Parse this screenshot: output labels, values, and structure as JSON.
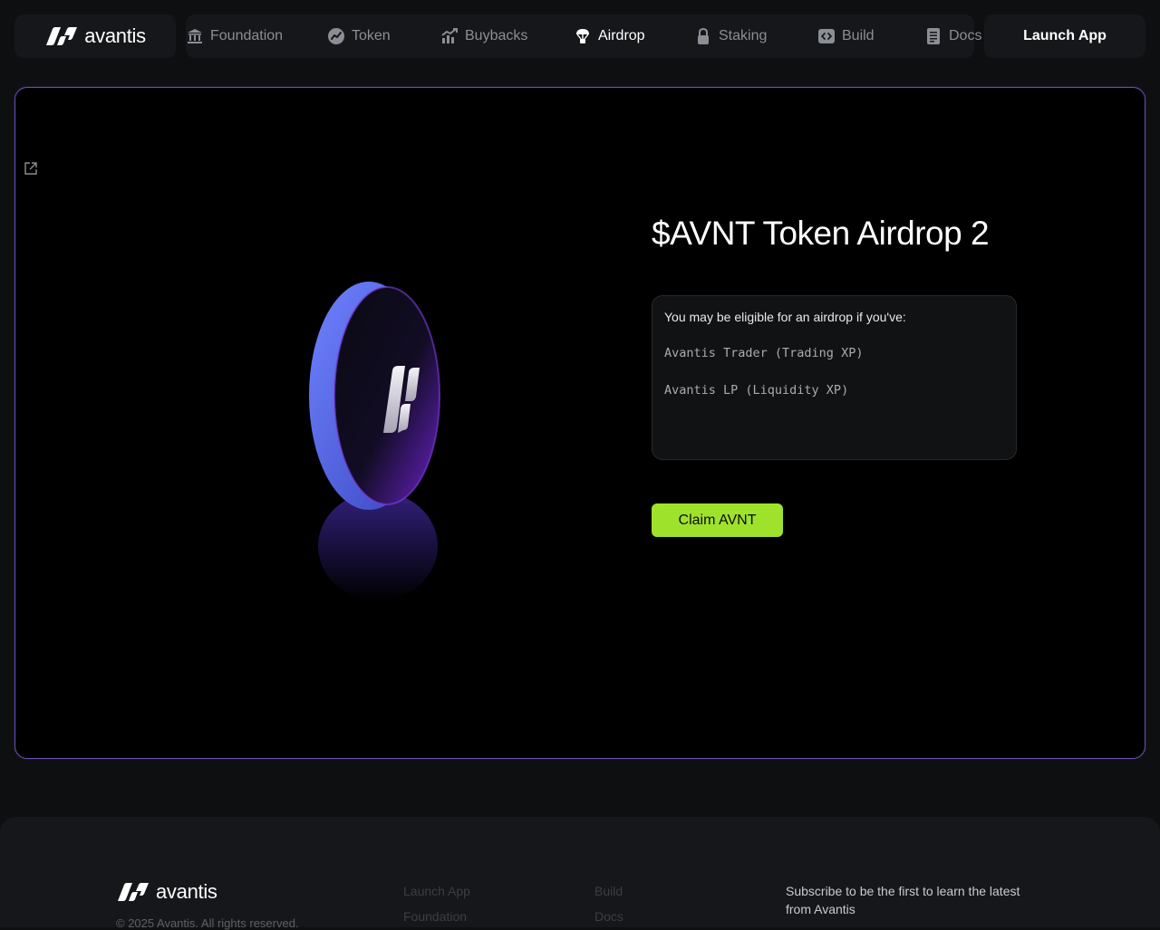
{
  "brand": {
    "name": "avantis"
  },
  "nav": {
    "items": [
      {
        "label": "Foundation",
        "icon": "bank-icon",
        "active": false
      },
      {
        "label": "Token",
        "icon": "token-chart-icon",
        "active": false
      },
      {
        "label": "Buybacks",
        "icon": "buyback-chart-icon",
        "active": false
      },
      {
        "label": "Airdrop",
        "icon": "parachute-icon",
        "active": true
      },
      {
        "label": "Staking",
        "icon": "lock-icon",
        "active": false
      },
      {
        "label": "Build",
        "icon": "code-icon",
        "active": false
      },
      {
        "label": "Docs",
        "icon": "document-icon",
        "active": false
      }
    ],
    "launch_label": "Launch App"
  },
  "hero": {
    "title": "$AVNT Token Airdrop 2",
    "eligibility_intro": "You may be eligible for an airdrop if you've:",
    "eligibility_items": [
      "Avantis Trader (Trading XP)",
      "Avantis LP (Liquidity XP)"
    ],
    "claim_label": "Claim AVNT"
  },
  "footer": {
    "brand": "avantis",
    "copyright": "© 2025 Avantis. All rights reserved.",
    "links_col1": [
      "Launch App",
      "Foundation"
    ],
    "links_col2": [
      "Build",
      "Docs"
    ],
    "subscribe_text": "Subscribe to be the first to learn the latest from Avantis"
  },
  "colors": {
    "accent_green": "#9fe22c",
    "hero_border": "#6b4fb5",
    "coin_blue": "#5566e0",
    "coin_purple": "#7b2fd6"
  }
}
